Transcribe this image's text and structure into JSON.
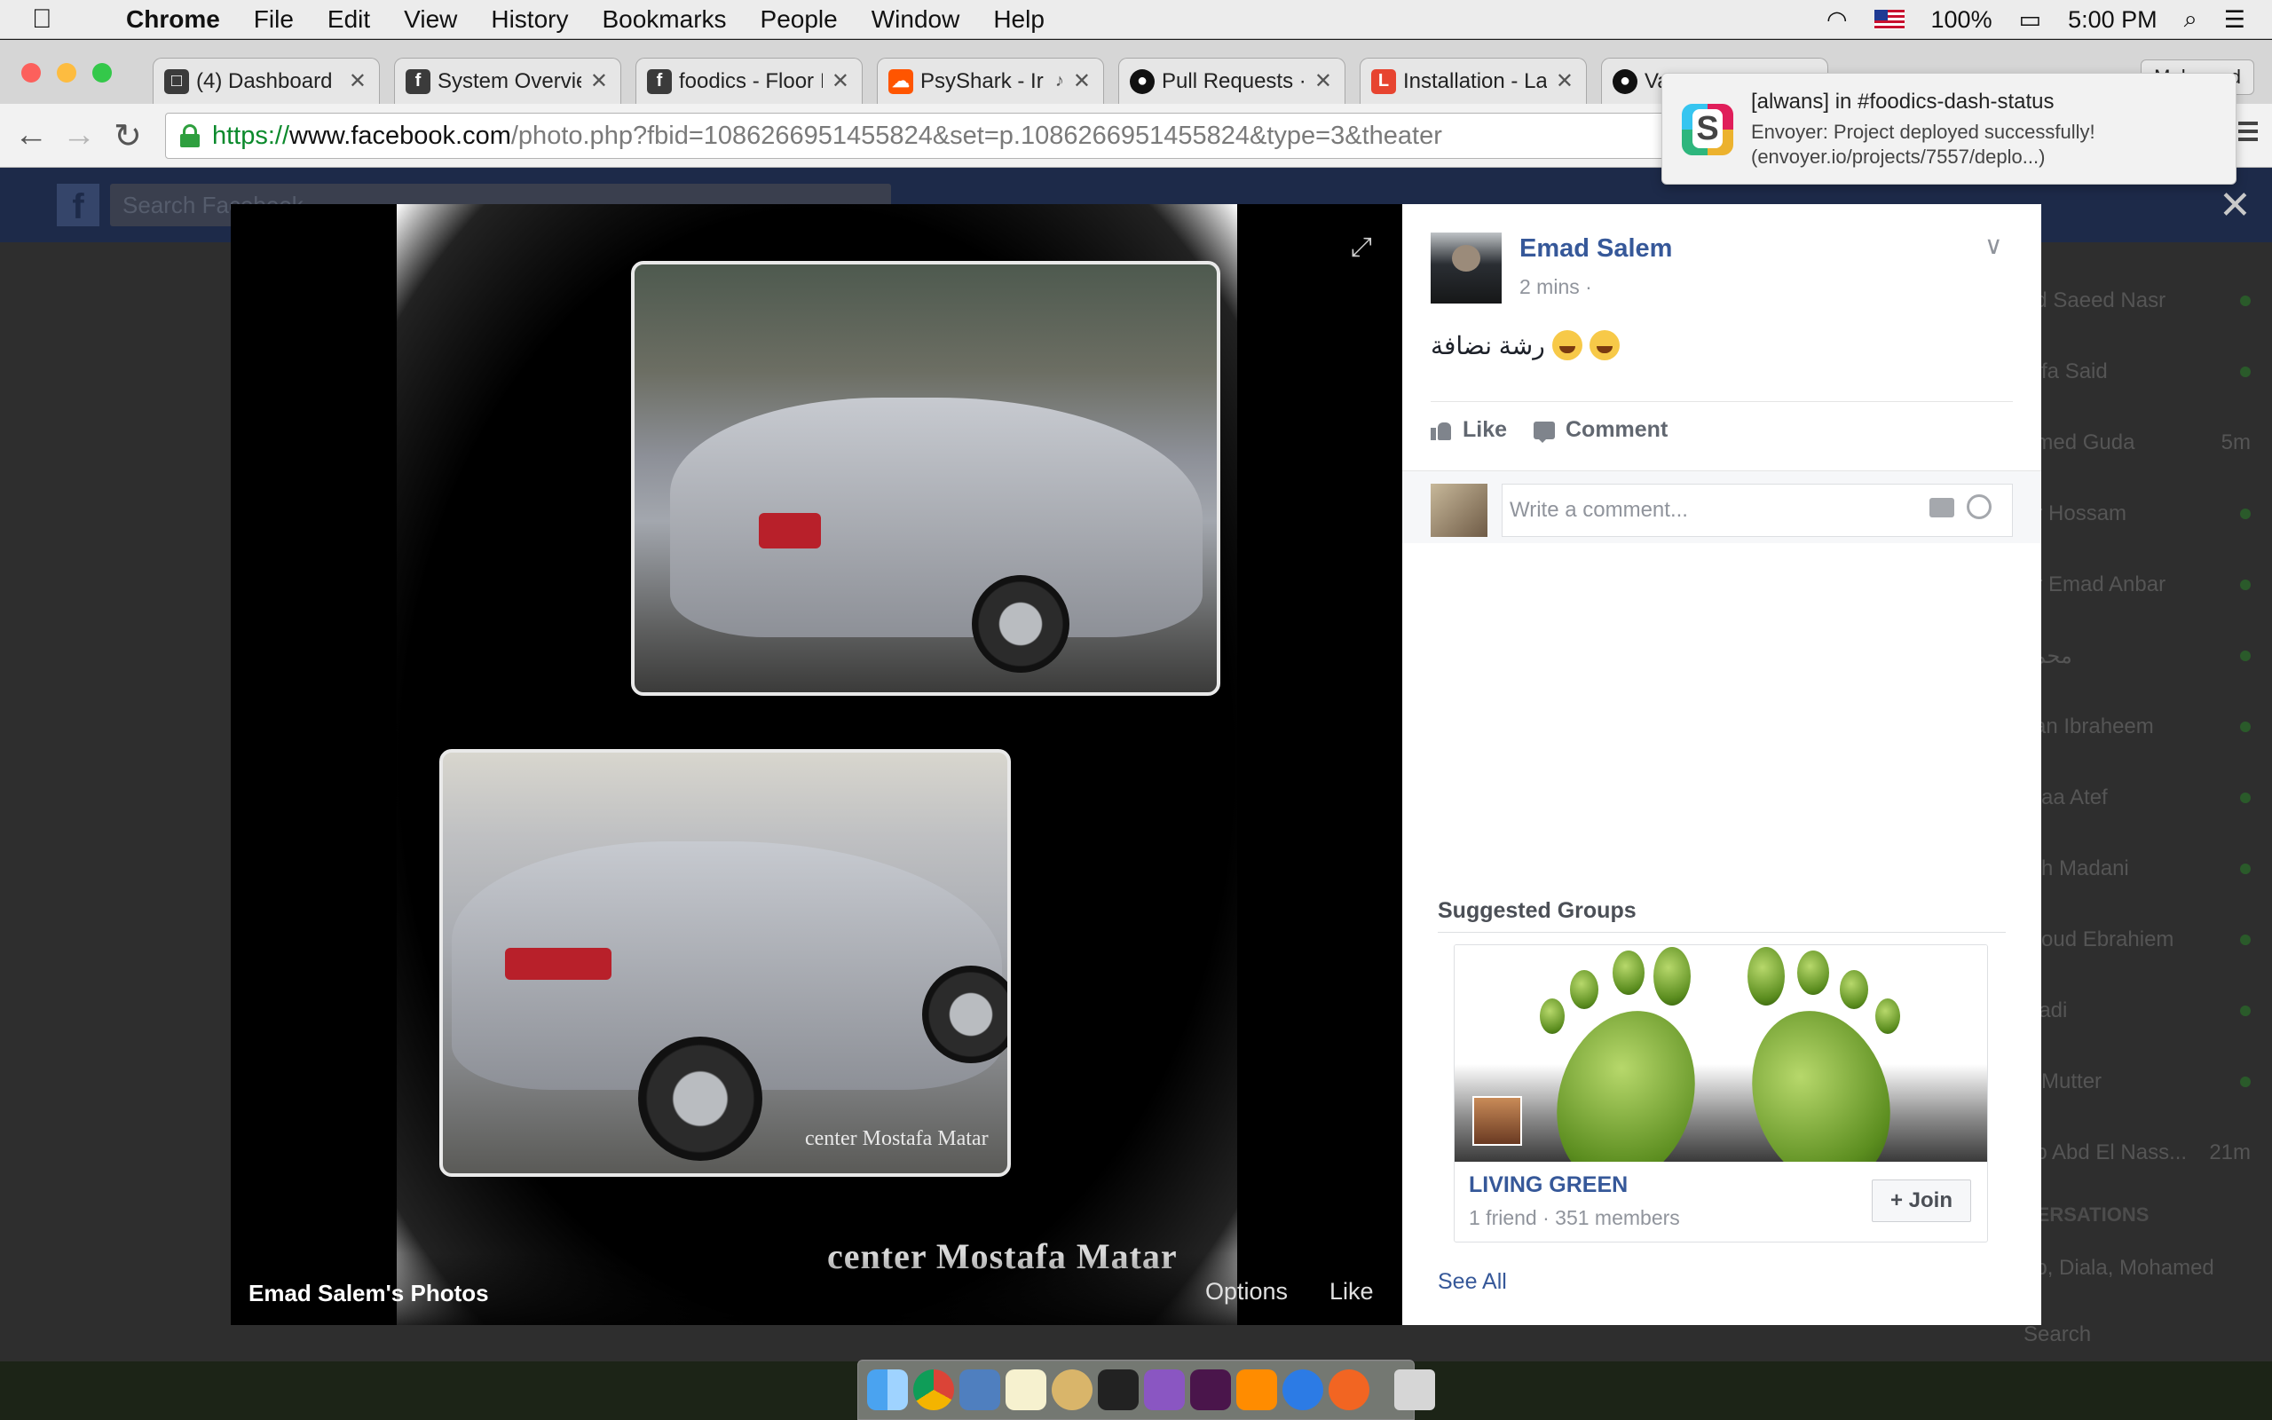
{
  "menubar": {
    "app": "Chrome",
    "items": [
      "File",
      "Edit",
      "View",
      "History",
      "Bookmarks",
      "People",
      "Window",
      "Help"
    ],
    "battery": "100%",
    "time": "5:00 PM"
  },
  "tabs": [
    {
      "title": "(4) Dashboard |",
      "favicon": "f-doc-icon",
      "color": "#3b3b3b"
    },
    {
      "title": "System Overvie",
      "favicon": "facebook-icon",
      "color": "#3b3b3b"
    },
    {
      "title": "foodics - Floor I",
      "favicon": "facebook-icon",
      "color": "#3b3b3b"
    },
    {
      "title": "PsyShark - Ir",
      "favicon": "soundcloud-icon",
      "color": "#ff5500"
    },
    {
      "title": "Pull Requests ·",
      "favicon": "github-icon",
      "color": "#111111"
    },
    {
      "title": "Installation - La",
      "favicon": "laravel-icon",
      "color": "#e74430"
    },
    {
      "title": "Va",
      "favicon": "github-icon",
      "color": "#111111"
    }
  ],
  "profile": "Mohamed",
  "address": {
    "scheme": "https://",
    "host": "www.facebook.com",
    "path": "/photo.php?fbid=1086266951455824&set=p.1086266951455824&type=3&theater"
  },
  "facebook": {
    "search_placeholder": "Search Facebook"
  },
  "chat_list": [
    {
      "name": "ed Saeed Nasr"
    },
    {
      "name": "tafa Said"
    },
    {
      "name": "amed Guda",
      "badge": "5m"
    },
    {
      "name": "ar Hossam"
    },
    {
      "name": "er Emad Anbar"
    },
    {
      "name": "محمد"
    },
    {
      "name": "san Ibraheem"
    },
    {
      "name": "maa Atef"
    },
    {
      "name": "ath Madani"
    },
    {
      "name": "moud Ebrahiem"
    },
    {
      "name": "Radi"
    },
    {
      "name": "d Mutter"
    },
    {
      "name": "ab Abd El Nass...",
      "badge": "21m"
    }
  ],
  "chat_section": "VERSATIONS",
  "chat_group": "ab, Diala, Mohamed",
  "chat_search": "Search",
  "photo": {
    "watermark_small": "center Mostafa Matar",
    "watermark_large": "center Mostafa Matar"
  },
  "caption": {
    "album": "Emad Salem's Photos",
    "options": "Options",
    "like": "Like"
  },
  "post": {
    "author": "Emad Salem",
    "time": "2 mins ·",
    "text": "رشة نضافة",
    "like_label": "Like",
    "comment_label": "Comment",
    "comment_placeholder": "Write a comment..."
  },
  "suggested": {
    "title": "Suggested Groups",
    "group_name": "LIVING GREEN",
    "group_meta": "1 friend · 351 members",
    "join_label": "+ Join",
    "see_all": "See All"
  },
  "notification": {
    "title": "[alwans] in #foodics-dash-status",
    "line1": "Envoyer: Project deployed successfully!",
    "line2": "(envoyer.io/projects/7557/deplo...)"
  }
}
